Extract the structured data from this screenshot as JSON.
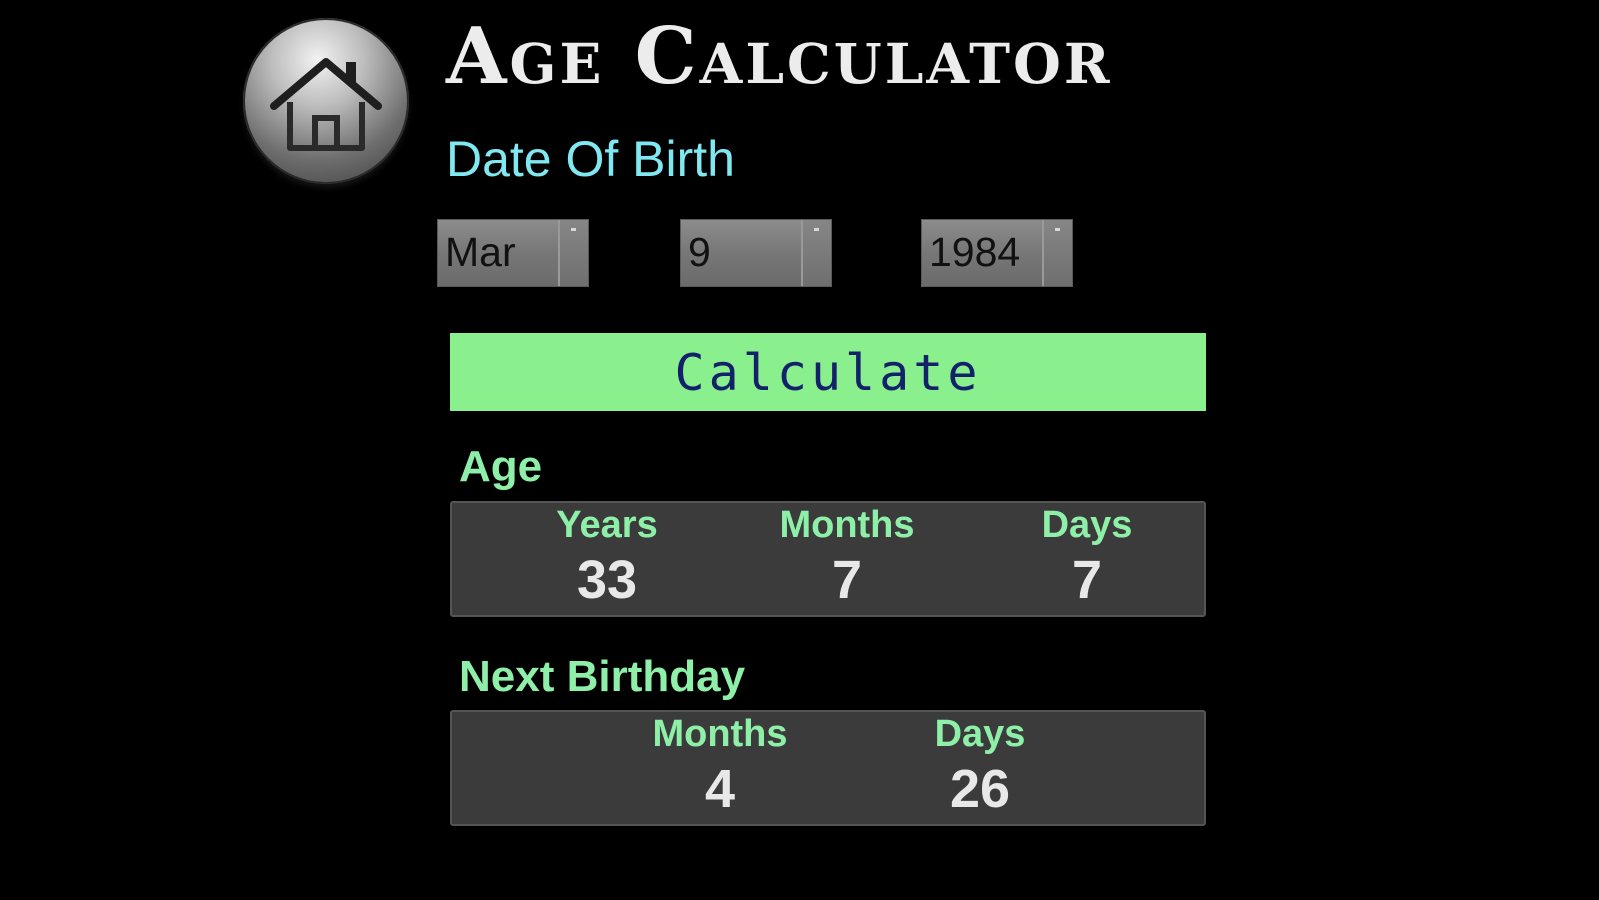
{
  "app": {
    "title": "Age Calculator",
    "home_icon": "home-icon"
  },
  "dob": {
    "label": "Date Of Birth",
    "month": "Mar",
    "day": "9",
    "year": "1984"
  },
  "calculate_label": "Calculate",
  "age": {
    "label": "Age",
    "years_label": "Years",
    "years": "33",
    "months_label": "Months",
    "months": "7",
    "days_label": "Days",
    "days": "7"
  },
  "next_birthday": {
    "label": "Next Birthday",
    "months_label": "Months",
    "months": "4",
    "days_label": "Days",
    "days": "26"
  },
  "colors": {
    "background": "#000000",
    "accent_button": "#8af08d",
    "label_cyan": "#7fe8f0",
    "label_green": "#8ef0a8",
    "panel": "#3b3b3b"
  }
}
